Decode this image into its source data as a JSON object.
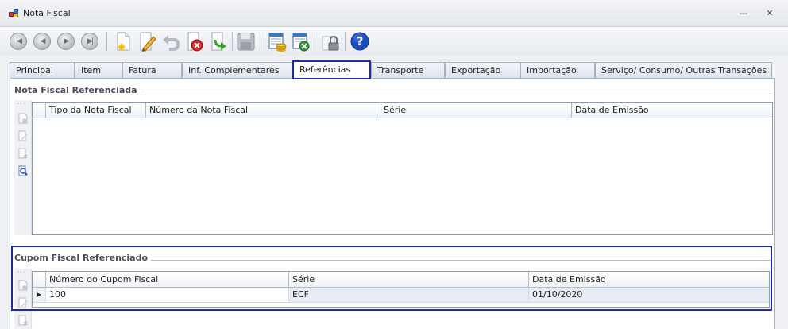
{
  "window": {
    "title": "Nota Fiscal",
    "minimize_icon": "minimize-icon",
    "close_icon": "close-icon"
  },
  "toolbar": {
    "buttons": [
      {
        "name": "first-record-icon"
      },
      {
        "name": "previous-record-icon"
      },
      {
        "name": "next-record-icon"
      },
      {
        "name": "last-record-icon"
      },
      {
        "name": "new-document-icon"
      },
      {
        "name": "edit-pencil-icon"
      },
      {
        "name": "undo-icon"
      },
      {
        "name": "delete-icon"
      },
      {
        "name": "refresh-arrow-icon"
      },
      {
        "name": "save-disk-icon"
      },
      {
        "name": "report-coins-icon"
      },
      {
        "name": "export-excel-icon"
      },
      {
        "name": "lock-icon"
      },
      {
        "name": "help-icon"
      }
    ],
    "help_glyph": "?"
  },
  "tabs": [
    {
      "label": "Principal"
    },
    {
      "label": "Item"
    },
    {
      "label": "Fatura"
    },
    {
      "label": "Inf. Complementares"
    },
    {
      "label": "Referências",
      "active": true
    },
    {
      "label": "Transporte"
    },
    {
      "label": "Exportação"
    },
    {
      "label": "Importação"
    },
    {
      "label": "Serviço/ Consumo/ Outras Transações"
    }
  ],
  "nota_fiscal": {
    "group_title": "Nota Fiscal Referenciada",
    "columns": [
      "Tipo da Nota Fiscal",
      "Número da Nota Fiscal",
      "Série",
      "Data de Emissão"
    ],
    "rows": []
  },
  "cupom_fiscal": {
    "group_title": "Cupom Fiscal Referenciado",
    "columns": [
      "Número do Cupom Fiscal",
      "Série",
      "Data de Emissão"
    ],
    "rows": [
      {
        "numero": "100",
        "serie": "ECF",
        "data": "01/10/2020"
      }
    ]
  },
  "colors": {
    "accent": "#1f2a9e",
    "tab_border": "#a7b2c3"
  }
}
